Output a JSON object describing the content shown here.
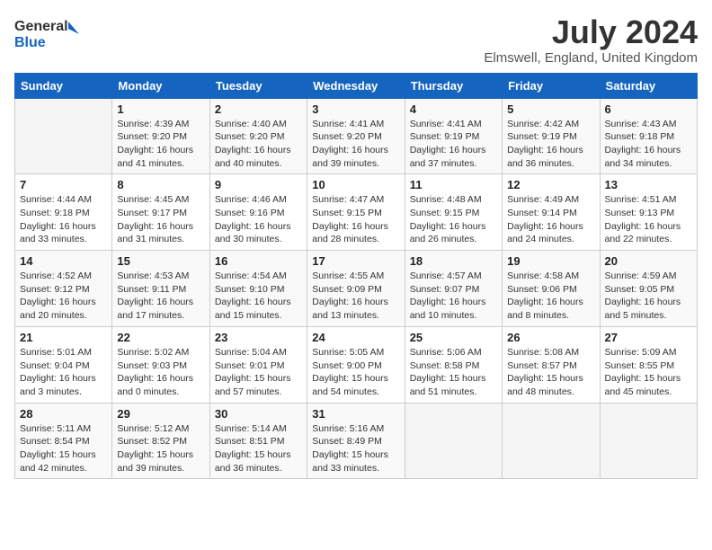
{
  "header": {
    "logo_general": "General",
    "logo_blue": "Blue",
    "month_title": "July 2024",
    "location": "Elmswell, England, United Kingdom"
  },
  "days_of_week": [
    "Sunday",
    "Monday",
    "Tuesday",
    "Wednesday",
    "Thursday",
    "Friday",
    "Saturday"
  ],
  "weeks": [
    [
      {
        "day": "",
        "info": ""
      },
      {
        "day": "1",
        "info": "Sunrise: 4:39 AM\nSunset: 9:20 PM\nDaylight: 16 hours and 41 minutes."
      },
      {
        "day": "2",
        "info": "Sunrise: 4:40 AM\nSunset: 9:20 PM\nDaylight: 16 hours and 40 minutes."
      },
      {
        "day": "3",
        "info": "Sunrise: 4:41 AM\nSunset: 9:20 PM\nDaylight: 16 hours and 39 minutes."
      },
      {
        "day": "4",
        "info": "Sunrise: 4:41 AM\nSunset: 9:19 PM\nDaylight: 16 hours and 37 minutes."
      },
      {
        "day": "5",
        "info": "Sunrise: 4:42 AM\nSunset: 9:19 PM\nDaylight: 16 hours and 36 minutes."
      },
      {
        "day": "6",
        "info": "Sunrise: 4:43 AM\nSunset: 9:18 PM\nDaylight: 16 hours and 34 minutes."
      }
    ],
    [
      {
        "day": "7",
        "info": "Sunrise: 4:44 AM\nSunset: 9:18 PM\nDaylight: 16 hours and 33 minutes."
      },
      {
        "day": "8",
        "info": "Sunrise: 4:45 AM\nSunset: 9:17 PM\nDaylight: 16 hours and 31 minutes."
      },
      {
        "day": "9",
        "info": "Sunrise: 4:46 AM\nSunset: 9:16 PM\nDaylight: 16 hours and 30 minutes."
      },
      {
        "day": "10",
        "info": "Sunrise: 4:47 AM\nSunset: 9:15 PM\nDaylight: 16 hours and 28 minutes."
      },
      {
        "day": "11",
        "info": "Sunrise: 4:48 AM\nSunset: 9:15 PM\nDaylight: 16 hours and 26 minutes."
      },
      {
        "day": "12",
        "info": "Sunrise: 4:49 AM\nSunset: 9:14 PM\nDaylight: 16 hours and 24 minutes."
      },
      {
        "day": "13",
        "info": "Sunrise: 4:51 AM\nSunset: 9:13 PM\nDaylight: 16 hours and 22 minutes."
      }
    ],
    [
      {
        "day": "14",
        "info": "Sunrise: 4:52 AM\nSunset: 9:12 PM\nDaylight: 16 hours and 20 minutes."
      },
      {
        "day": "15",
        "info": "Sunrise: 4:53 AM\nSunset: 9:11 PM\nDaylight: 16 hours and 17 minutes."
      },
      {
        "day": "16",
        "info": "Sunrise: 4:54 AM\nSunset: 9:10 PM\nDaylight: 16 hours and 15 minutes."
      },
      {
        "day": "17",
        "info": "Sunrise: 4:55 AM\nSunset: 9:09 PM\nDaylight: 16 hours and 13 minutes."
      },
      {
        "day": "18",
        "info": "Sunrise: 4:57 AM\nSunset: 9:07 PM\nDaylight: 16 hours and 10 minutes."
      },
      {
        "day": "19",
        "info": "Sunrise: 4:58 AM\nSunset: 9:06 PM\nDaylight: 16 hours and 8 minutes."
      },
      {
        "day": "20",
        "info": "Sunrise: 4:59 AM\nSunset: 9:05 PM\nDaylight: 16 hours and 5 minutes."
      }
    ],
    [
      {
        "day": "21",
        "info": "Sunrise: 5:01 AM\nSunset: 9:04 PM\nDaylight: 16 hours and 3 minutes."
      },
      {
        "day": "22",
        "info": "Sunrise: 5:02 AM\nSunset: 9:03 PM\nDaylight: 16 hours and 0 minutes."
      },
      {
        "day": "23",
        "info": "Sunrise: 5:04 AM\nSunset: 9:01 PM\nDaylight: 15 hours and 57 minutes."
      },
      {
        "day": "24",
        "info": "Sunrise: 5:05 AM\nSunset: 9:00 PM\nDaylight: 15 hours and 54 minutes."
      },
      {
        "day": "25",
        "info": "Sunrise: 5:06 AM\nSunset: 8:58 PM\nDaylight: 15 hours and 51 minutes."
      },
      {
        "day": "26",
        "info": "Sunrise: 5:08 AM\nSunset: 8:57 PM\nDaylight: 15 hours and 48 minutes."
      },
      {
        "day": "27",
        "info": "Sunrise: 5:09 AM\nSunset: 8:55 PM\nDaylight: 15 hours and 45 minutes."
      }
    ],
    [
      {
        "day": "28",
        "info": "Sunrise: 5:11 AM\nSunset: 8:54 PM\nDaylight: 15 hours and 42 minutes."
      },
      {
        "day": "29",
        "info": "Sunrise: 5:12 AM\nSunset: 8:52 PM\nDaylight: 15 hours and 39 minutes."
      },
      {
        "day": "30",
        "info": "Sunrise: 5:14 AM\nSunset: 8:51 PM\nDaylight: 15 hours and 36 minutes."
      },
      {
        "day": "31",
        "info": "Sunrise: 5:16 AM\nSunset: 8:49 PM\nDaylight: 15 hours and 33 minutes."
      },
      {
        "day": "",
        "info": ""
      },
      {
        "day": "",
        "info": ""
      },
      {
        "day": "",
        "info": ""
      }
    ]
  ]
}
